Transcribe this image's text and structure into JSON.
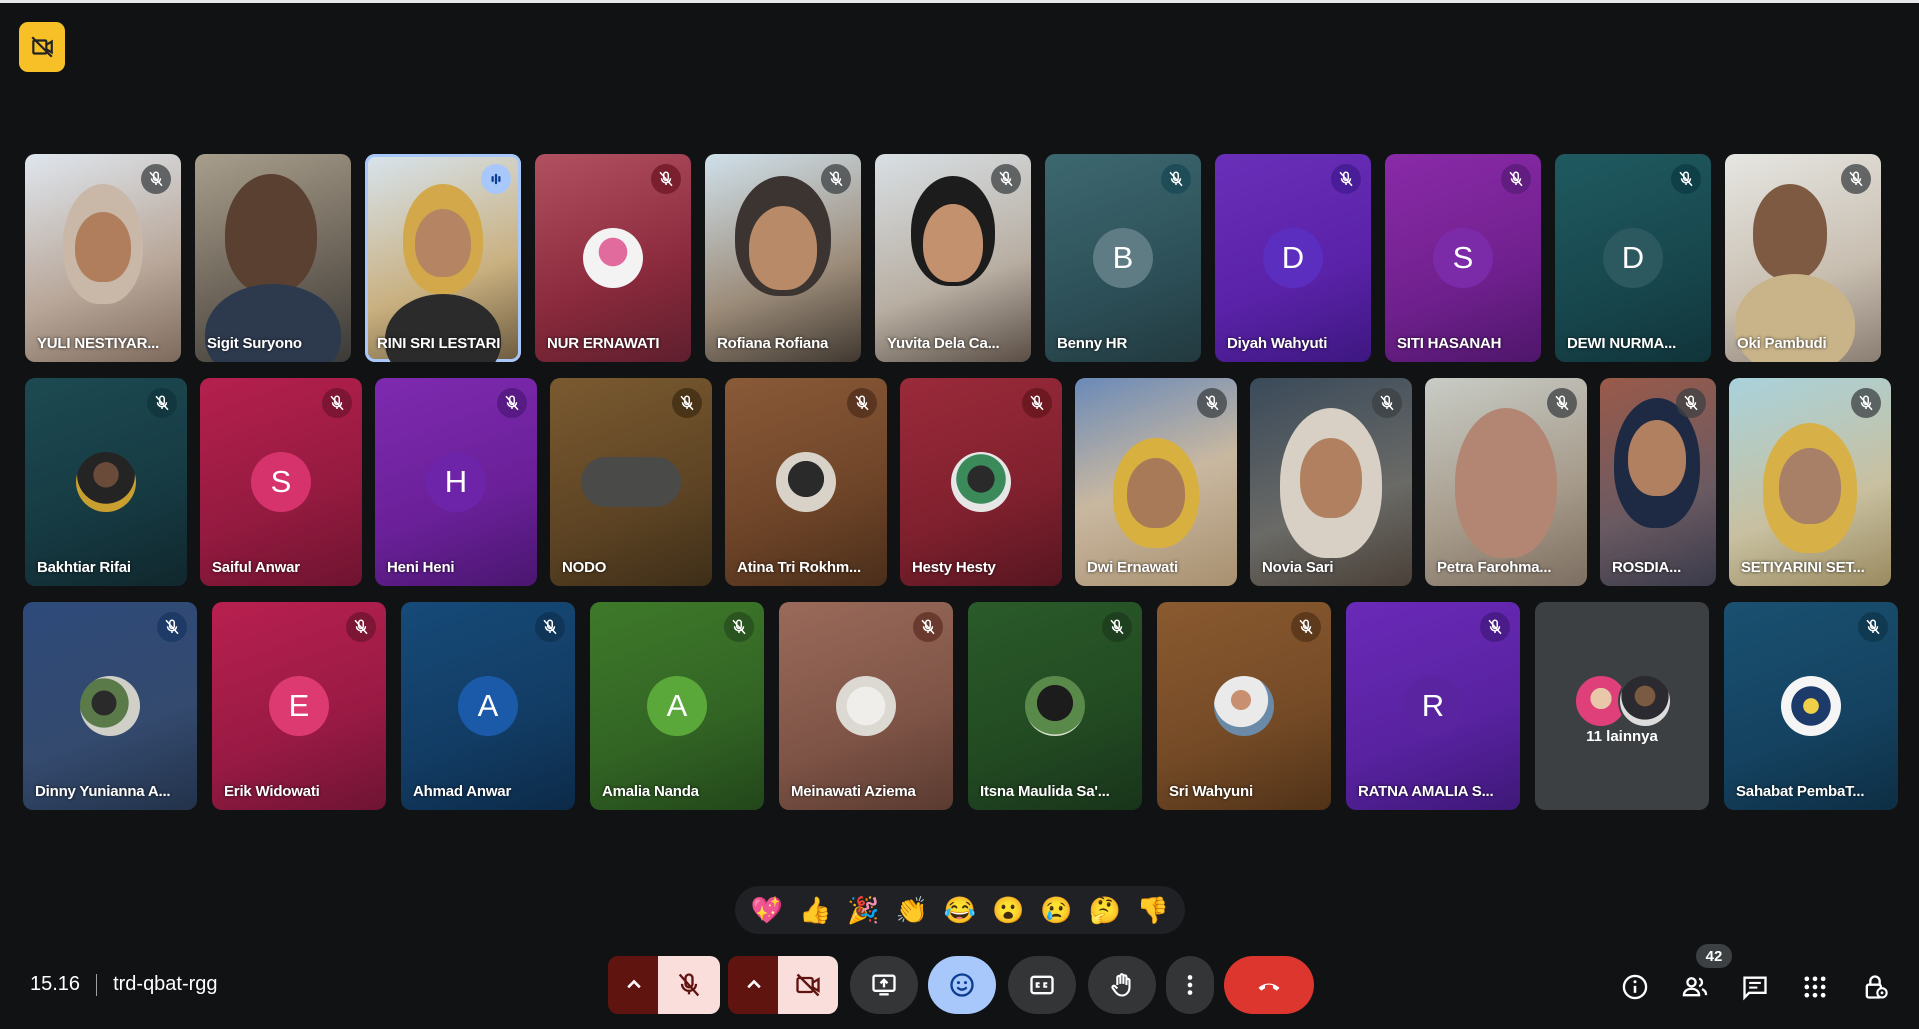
{
  "meeting": {
    "time": "15.16",
    "code": "trd-qbat-rgg"
  },
  "row1": [
    {
      "name": "YULI NESTIYAR..."
    },
    {
      "name": "Sigit Suryono"
    },
    {
      "name": "RINI SRI LESTARI"
    },
    {
      "name": "NUR ERNAWATI"
    },
    {
      "name": "Rofiana Rofiana"
    },
    {
      "name": "Yuvita Dela Ca..."
    },
    {
      "name": "Benny HR",
      "initial": "B"
    },
    {
      "name": "Diyah Wahyuti",
      "initial": "D"
    },
    {
      "name": "SITI HASANAH",
      "initial": "S"
    },
    {
      "name": "DEWI NURMA...",
      "initial": "D"
    },
    {
      "name": "Oki Pambudi"
    }
  ],
  "row2": [
    {
      "name": "Bakhtiar Rifai"
    },
    {
      "name": "Saiful Anwar",
      "initial": "S"
    },
    {
      "name": "Heni Heni",
      "initial": "H"
    },
    {
      "name": "NODO"
    },
    {
      "name": "Atina Tri Rokhm..."
    },
    {
      "name": "Hesty Hesty"
    },
    {
      "name": "Dwi Ernawati"
    },
    {
      "name": "Novia Sari"
    },
    {
      "name": "Petra Farohma..."
    },
    {
      "name": "ROSDIA..."
    },
    {
      "name": "SETIYARINI SET..."
    }
  ],
  "row3": [
    {
      "name": "Dinny Yunianna A..."
    },
    {
      "name": "Erik Widowati",
      "initial": "E"
    },
    {
      "name": "Ahmad Anwar",
      "initial": "A"
    },
    {
      "name": "Amalia Nanda",
      "initial": "A"
    },
    {
      "name": "Meinawati Aziema"
    },
    {
      "name": "Itsna Maulida Sa'..."
    },
    {
      "name": "Sri Wahyuni"
    },
    {
      "name": "RATNA AMALIA S...",
      "initial": "R"
    },
    {
      "name": "11 lainnya"
    },
    {
      "name": "Sahabat PembaT..."
    }
  ],
  "reactions": [
    "💖",
    "👍",
    "🎉",
    "👏",
    "😂",
    "😮",
    "😢",
    "🤔",
    "👎"
  ],
  "participants_count": "42",
  "icons": {
    "recording": "no-video-recording-icon",
    "mic_off": "mic-off-icon",
    "speaking": "audio-waveform-icon",
    "controls": [
      "chevron-up-icon",
      "mic-off-icon",
      "chevron-up-icon",
      "camera-off-icon",
      "present-screen-icon",
      "emoji-icon",
      "captions-icon",
      "raise-hand-icon",
      "more-vert-icon",
      "end-call-icon"
    ],
    "right": [
      "info-icon",
      "people-icon",
      "chat-icon",
      "activities-icon",
      "host-controls-icon"
    ]
  },
  "colors": {
    "accent_blue": "#a8c7fa",
    "end_call_red": "#dc362e",
    "recording_yellow": "#f6c026"
  }
}
